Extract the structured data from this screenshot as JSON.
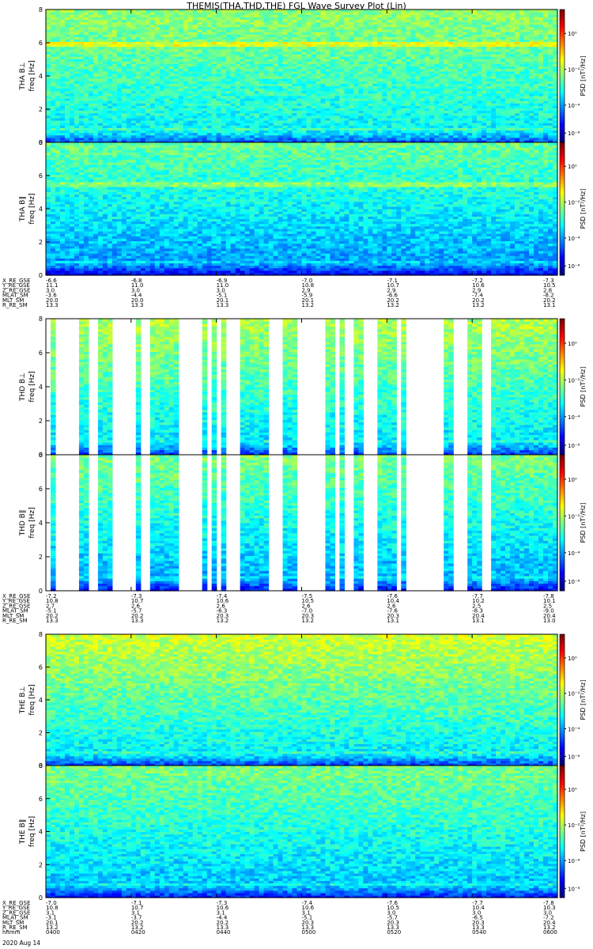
{
  "title": "THEMIS(THA,THD,THE) FGL Wave Survey Plot (Lin)",
  "footer": {
    "hhmm": "hhmm",
    "date": "2020 Aug 14"
  },
  "colorbar": {
    "label": "PSD [nT²/Hz]",
    "ticks": [
      "10⁰",
      "10⁻²",
      "10⁻⁴",
      "10⁻⁶"
    ]
  },
  "chart_data": [
    {
      "type": "heatmap",
      "group": "THA",
      "panels": [
        {
          "ylabel_line1": "THA B⊥",
          "ylabel_line2": "freq [Hz]",
          "ylim": [
            0,
            8
          ],
          "yticks": [
            "0",
            "2",
            "4",
            "6",
            "8"
          ],
          "colorbar_ticks": [
            "10⁰",
            "10⁻²",
            "10⁻⁴",
            "10⁻⁶"
          ],
          "pattern": "tha_perp"
        },
        {
          "ylabel_line1": "THA B∥",
          "ylabel_line2": "freq [Hz]",
          "ylim": [
            0,
            8
          ],
          "yticks": [
            "0",
            "2",
            "4",
            "6",
            "8"
          ],
          "colorbar_ticks": [
            "10⁰",
            "10⁻²",
            "10⁻⁴",
            "10⁻⁶"
          ],
          "pattern": "tha_para"
        }
      ],
      "ephemeris": {
        "labels": [
          "X_RE_GSE",
          "Y_RE_GSE",
          "Z_RE_GSE",
          "MLAT_SM",
          "MLT_SM",
          "R_RE_SM"
        ],
        "rows": [
          [
            "-6.6",
            "-6.8",
            "-6.9",
            "-7.0",
            "-7.1",
            "-7.2",
            "-7.3"
          ],
          [
            "11.1",
            "11.0",
            "11.0",
            "10.8",
            "10.7",
            "10.6",
            "10.5"
          ],
          [
            "3.0",
            "3.0",
            "3.0",
            "2.9",
            "2.9",
            "2.9",
            "2.8"
          ],
          [
            "-3.6",
            "-4.4",
            "-5.1",
            "-5.9",
            "-6.6",
            "-7.4",
            "-8.2"
          ],
          [
            "20.0",
            "20.0",
            "20.1",
            "20.1",
            "20.2",
            "20.2",
            "20.2"
          ],
          [
            "13.3",
            "13.3",
            "13.3",
            "13.2",
            "13.2",
            "13.2",
            "13.1"
          ]
        ]
      }
    },
    {
      "type": "heatmap",
      "group": "THD",
      "panels": [
        {
          "ylabel_line1": "THD B⊥",
          "ylabel_line2": "freq [Hz]",
          "ylim": [
            0,
            8
          ],
          "yticks": [
            "0",
            "2",
            "4",
            "6",
            "8"
          ],
          "colorbar_ticks": [
            "10⁰",
            "10⁻²",
            "10⁻⁴",
            "10⁻⁶"
          ],
          "pattern": "thd_perp"
        },
        {
          "ylabel_line1": "THD B∥",
          "ylabel_line2": "freq [Hz]",
          "ylim": [
            0,
            8
          ],
          "yticks": [
            "0",
            "2",
            "4",
            "6",
            "8"
          ],
          "colorbar_ticks": [
            "10⁰",
            "10⁻²",
            "10⁻⁴",
            "10⁻⁶"
          ],
          "pattern": "thd_para"
        }
      ],
      "data_gaps_hhmm": [
        [
          "04:00",
          "04:01"
        ],
        [
          "04:02",
          "04:05"
        ],
        [
          "04:06",
          "04:08"
        ],
        [
          "04:10",
          "04:12"
        ],
        [
          "04:16",
          "04:21"
        ],
        [
          "04:22",
          "04:24"
        ],
        [
          "04:31",
          "04:37"
        ],
        [
          "04:38",
          "04:39"
        ],
        [
          "04:40",
          "04:41"
        ],
        [
          "04:42",
          "04:46"
        ],
        [
          "04:52",
          "04:56"
        ],
        [
          "04:59",
          "05:06"
        ],
        [
          "05:08",
          "05:09"
        ],
        [
          "05:10",
          "05:12"
        ],
        [
          "05:14",
          "05:18"
        ],
        [
          "05:22",
          "05:23"
        ],
        [
          "05:24",
          "05:33"
        ],
        [
          "05:36",
          "05:37"
        ],
        [
          "05:37",
          "05:38"
        ],
        [
          "05:38",
          "05:39"
        ],
        [
          "05:42",
          "05:44"
        ]
      ],
      "ephemeris": {
        "labels": [
          "X_RE_GSE",
          "Y_RE_GSE",
          "Z_RE_GSE",
          "MLAT_SM",
          "MLT_SM",
          "R_RE_SM"
        ],
        "rows": [
          [
            "-7.2",
            "-7.3",
            "-7.4",
            "-7.5",
            "-7.6",
            "-7.7",
            "-7.8"
          ],
          [
            "10.8",
            "10.7",
            "10.6",
            "10.5",
            "10.4",
            "10.2",
            "10.1"
          ],
          [
            "2.7",
            "2.6",
            "2.6",
            "2.6",
            "2.6",
            "2.5",
            "2.5"
          ],
          [
            "-5.1",
            "-5.7",
            "-6.3",
            "-7.0",
            "-7.6",
            "-8.3",
            "-9.0"
          ],
          [
            "20.2",
            "20.2",
            "20.3",
            "20.3",
            "20.3",
            "20.4",
            "20.4"
          ],
          [
            "13.3",
            "13.3",
            "13.2",
            "13.2",
            "13.1",
            "13.1",
            "13.0"
          ]
        ]
      }
    },
    {
      "type": "heatmap",
      "group": "THE",
      "panels": [
        {
          "ylabel_line1": "THE B⊥",
          "ylabel_line2": "freq [Hz]",
          "ylim": [
            0,
            8
          ],
          "yticks": [
            "0",
            "2",
            "4",
            "6",
            "8"
          ],
          "colorbar_ticks": [
            "10⁰",
            "10⁻²",
            "10⁻⁴",
            "10⁻⁶"
          ],
          "pattern": "the_perp"
        },
        {
          "ylabel_line1": "THE B∥",
          "ylabel_line2": "freq [Hz]",
          "ylim": [
            0,
            8
          ],
          "yticks": [
            "0",
            "2",
            "4",
            "6",
            "8"
          ],
          "colorbar_ticks": [
            "10⁰",
            "10⁻²",
            "10⁻⁴",
            "10⁻⁶"
          ],
          "pattern": "the_para"
        }
      ],
      "ephemeris": {
        "labels": [
          "X_RE_GSE",
          "Y_RE_GSE",
          "Z_RE_GSE",
          "MLAT_SM",
          "MLT_SM",
          "R_RE_SM",
          "hhmm"
        ],
        "rows": [
          [
            "-7.0",
            "-7.1",
            "-7.3",
            "-7.4",
            "-7.6",
            "-7.7",
            "-7.8"
          ],
          [
            "10.8",
            "10.7",
            "10.6",
            "10.6",
            "10.5",
            "10.4",
            "10.3"
          ],
          [
            "3.1",
            "3.1",
            "3.1",
            "3.1",
            "3.0",
            "3.0",
            "3.0"
          ],
          [
            "-3.1",
            "-3.7",
            "-4.4",
            "-5.1",
            "-5.7",
            "-6.5",
            "-7.2"
          ],
          [
            "20.1",
            "20.2",
            "20.2",
            "20.3",
            "20.3",
            "20.3",
            "20.4"
          ],
          [
            "13.2",
            "13.2",
            "13.3",
            "13.3",
            "13.3",
            "13.3",
            "13.2"
          ],
          [
            "0400",
            "0420",
            "0440",
            "0500",
            "0520",
            "0540",
            "0600"
          ]
        ]
      }
    }
  ]
}
